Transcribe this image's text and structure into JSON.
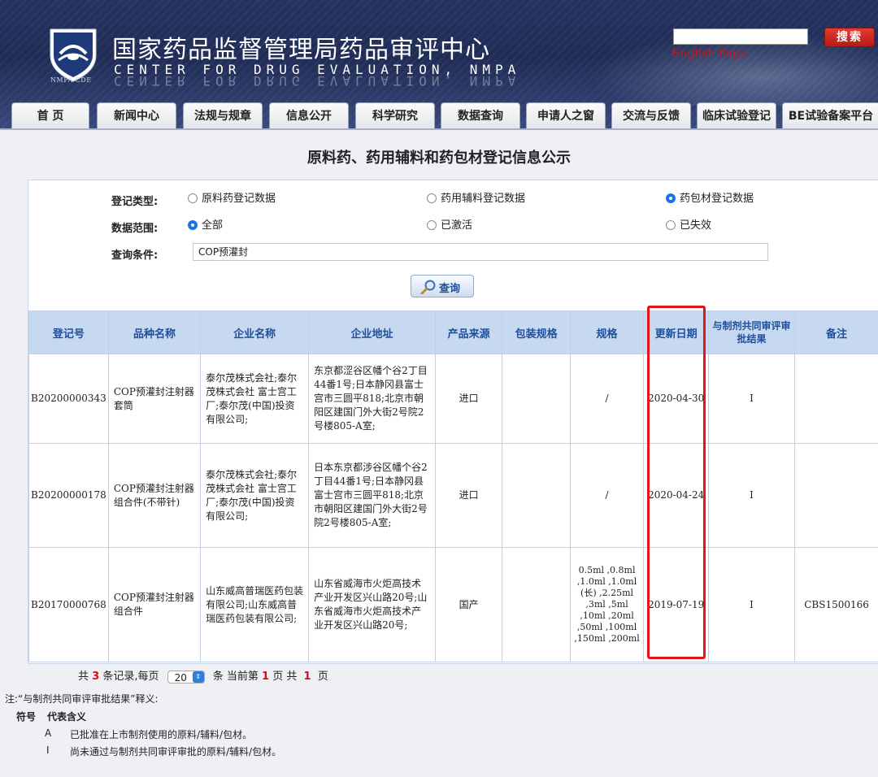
{
  "header": {
    "title": "国家药品监督管理局药品审评中心",
    "subtitle": "CENTER FOR DRUG EVALUATION, NMPA",
    "logo_text": "NMPA CDE",
    "search_button": "搜索",
    "english_link": "English Page"
  },
  "nav": {
    "tabs": [
      "首 页",
      "新闻中心",
      "法规与规章",
      "信息公开",
      "科学研究",
      "数据查询",
      "申请人之窗",
      "交流与反馈",
      "临床试验登记",
      "BE试验备案平台"
    ]
  },
  "page_title": "原料药、药用辅料和药包材登记信息公示",
  "form": {
    "type_label": "登记类型:",
    "type_options": [
      "原料药登记数据",
      "药用辅料登记数据",
      "药包材登记数据"
    ],
    "type_selected": 2,
    "scope_label": "数据范围:",
    "scope_options": [
      "全部",
      "已激活",
      "已失效"
    ],
    "scope_selected": 0,
    "query_label": "查询条件:",
    "query_value": "COP预灌封",
    "query_button": "查询"
  },
  "table": {
    "headers": [
      "登记号",
      "品种名称",
      "企业名称",
      "企业地址",
      "产品来源",
      "包装规格",
      "规格",
      "更新日期",
      "与制剂共同审评审批结果",
      "备注"
    ],
    "rows": [
      {
        "reg_no": "B20200000343",
        "name": "COP预灌封注射器套筒",
        "company": "泰尔茂株式会社;泰尔茂株式会社 富士宫工厂;泰尔茂(中国)投资有限公司;",
        "address": "东京都涩谷区幡个谷2丁目44番1号;日本静冈县富士宫市三圆平818;北京市朝阳区建国门外大街2号院2号楼805-A室;",
        "source": "进口",
        "package": "",
        "spec": "/",
        "date": "2020-04-30",
        "result": "I",
        "remark": ""
      },
      {
        "reg_no": "B20200000178",
        "name": "COP预灌封注射器组合件(不带针)",
        "company": "泰尔茂株式会社;泰尔茂株式会社 富士宫工厂;泰尔茂(中国)投资有限公司;",
        "address": "日本东京都涉谷区幡个谷2丁目44番1号;日本静冈县富士宫市三圆平818;北京市朝阳区建国门外大街2号院2号楼805-A室;",
        "source": "进口",
        "package": "",
        "spec": "/",
        "date": "2020-04-24",
        "result": "I",
        "remark": ""
      },
      {
        "reg_no": "B20170000768",
        "name": "COP预灌封注射器组合件",
        "company": "山东威高普瑞医药包装有限公司;山东威高普瑞医药包装有限公司;",
        "address": "山东省威海市火炬高技术产业开发区兴山路20号;山东省威海市火炬高技术产业开发区兴山路20号;",
        "source": "国产",
        "package": "",
        "spec": "0.5ml ,0.8ml ,1.0ml ,1.0ml (长) ,2.25ml ,3ml ,5ml ,10ml ,20ml ,50ml ,100ml ,150ml ,200ml",
        "date": "2019-07-19",
        "result": "I",
        "remark": "CBS1500166"
      }
    ]
  },
  "pager": {
    "prefix": "共",
    "total": "3",
    "mid1": "条记录,每页",
    "page_size": "20",
    "mid2": "条 当前第",
    "current": "1",
    "mid3": "页 共",
    "pages": "1",
    "suffix": "页"
  },
  "notes": {
    "heading": "注:“与制剂共同审评审批结果”释义:",
    "col_symbol": "符号",
    "col_meaning": "代表含义",
    "items": [
      {
        "symbol": "A",
        "meaning": "已批准在上市制剂使用的原料/辅料/包材。"
      },
      {
        "symbol": "I",
        "meaning": "尚未通过与制剂共同审评审批的原料/辅料/包材。"
      }
    ]
  },
  "colors": {
    "header_bg": "#1f2c56",
    "table_header_bg": "#c6d9f0",
    "table_header_text": "#1f4f9c",
    "highlight_box": "#e3141c",
    "accent_red": "#d0101a"
  }
}
